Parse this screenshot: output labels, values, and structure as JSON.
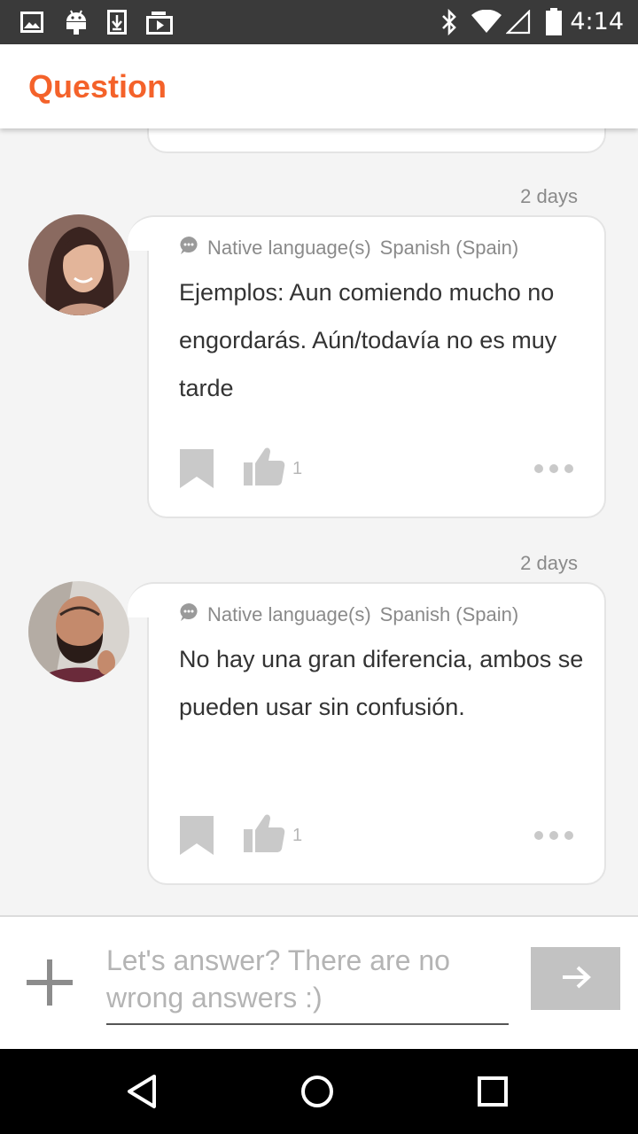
{
  "status_bar": {
    "time": "4:14",
    "left_icons": [
      "image-icon",
      "android-icon",
      "download-icon",
      "media-icon"
    ],
    "right_icons": [
      "bluetooth-icon",
      "wifi-icon",
      "signal-icon",
      "battery-icon"
    ]
  },
  "app_bar": {
    "title": "Question",
    "accent_color": "#f4622a"
  },
  "answers": [
    {
      "time": "2 days",
      "native_label": "Native language(s)",
      "native_value": "Spanish (Spain)",
      "text": "Ejemplos: Aun comiendo mucho no engordarás. Aún/todavía no es muy tarde",
      "likes": "1"
    },
    {
      "time": "2 days",
      "native_label": "Native language(s)",
      "native_value": "Spanish (Spain)",
      "text": "No hay una gran diferencia, ambos se pueden usar sin confusión.",
      "likes": "1"
    }
  ],
  "composer": {
    "placeholder": "Let's answer? There are no wrong answers :)",
    "value": ""
  },
  "nav_bar": {
    "buttons": [
      "back-icon",
      "home-icon",
      "recents-icon"
    ]
  }
}
